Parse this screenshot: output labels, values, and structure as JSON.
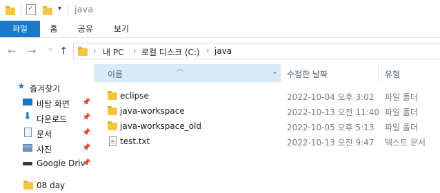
{
  "window": {
    "title": "java"
  },
  "ribbon": {
    "tabs": [
      "파일",
      "홈",
      "공유",
      "보기"
    ]
  },
  "nav_buttons": {
    "back": "←",
    "forward": "→",
    "recent": "⌄",
    "up": "↑"
  },
  "address": {
    "crumbs": [
      "내 PC",
      "로컬 디스크 (C:)",
      "java"
    ],
    "separator": "›"
  },
  "nav_pane": {
    "items": [
      {
        "label": "즐겨찾기",
        "icon": "star-icon",
        "pinned": false
      },
      {
        "label": "바탕 화면",
        "icon": "desktop-icon",
        "pinned": true
      },
      {
        "label": "다운로드",
        "icon": "download-icon",
        "pinned": true
      },
      {
        "label": "문서",
        "icon": "documents-icon",
        "pinned": true
      },
      {
        "label": "사진",
        "icon": "pictures-icon",
        "pinned": true
      },
      {
        "label": "Google Driv",
        "icon": "drive-icon",
        "pinned": true
      },
      {
        "label": "08 day",
        "icon": "folder-icon",
        "pinned": false
      }
    ],
    "pin_glyph": "📌"
  },
  "columns": {
    "name": "이름",
    "modified": "수정한 날짜",
    "type": "유형"
  },
  "files": [
    {
      "name": "eclipse",
      "modified": "2022-10-04 오후 3:02",
      "type": "파일 폴더",
      "kind": "folder"
    },
    {
      "name": "java-workspace",
      "modified": "2022-10-13 오전 11:40",
      "type": "파일 폴더",
      "kind": "folder"
    },
    {
      "name": "java-workspace_old",
      "modified": "2022-10-05 오후 5:13",
      "type": "파일 폴더",
      "kind": "folder"
    },
    {
      "name": "test.txt",
      "modified": "2022-10-13 오전 9:47",
      "type": "텍스트 문서",
      "kind": "text-file"
    }
  ],
  "colors": {
    "accent": "#1979ca",
    "folder": "#f4c542",
    "header_selected": "#d9ebf9"
  }
}
